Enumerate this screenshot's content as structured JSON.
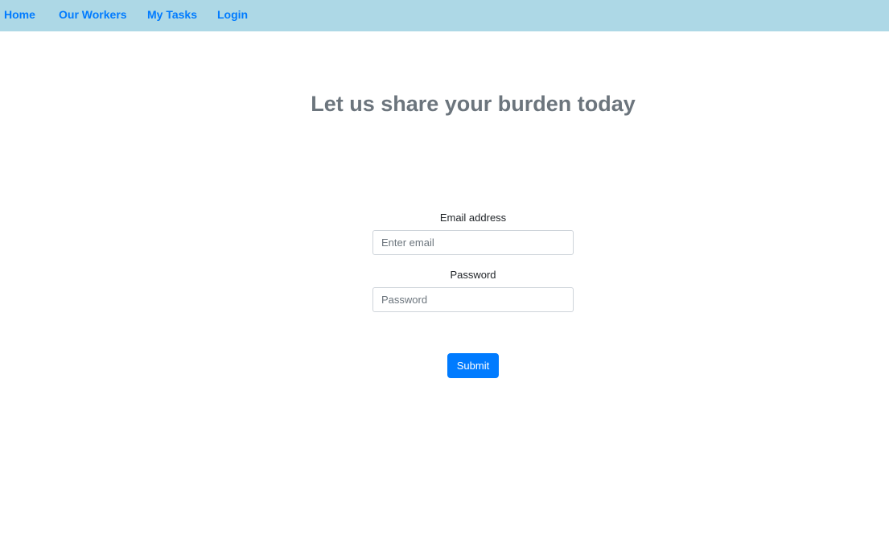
{
  "nav": {
    "items": [
      {
        "label": "Home"
      },
      {
        "label": "Our Workers"
      },
      {
        "label": "My Tasks"
      },
      {
        "label": "Login"
      }
    ]
  },
  "headline": "Let us share your burden today",
  "form": {
    "email_label": "Email address",
    "email_placeholder": "Enter email",
    "email_value": "",
    "password_label": "Password",
    "password_placeholder": "Password",
    "password_value": "",
    "submit_label": "Submit"
  },
  "colors": {
    "navbar_bg": "#add8e6",
    "nav_link": "#007bff",
    "headline": "#6c757d",
    "button_bg": "#007bff"
  }
}
